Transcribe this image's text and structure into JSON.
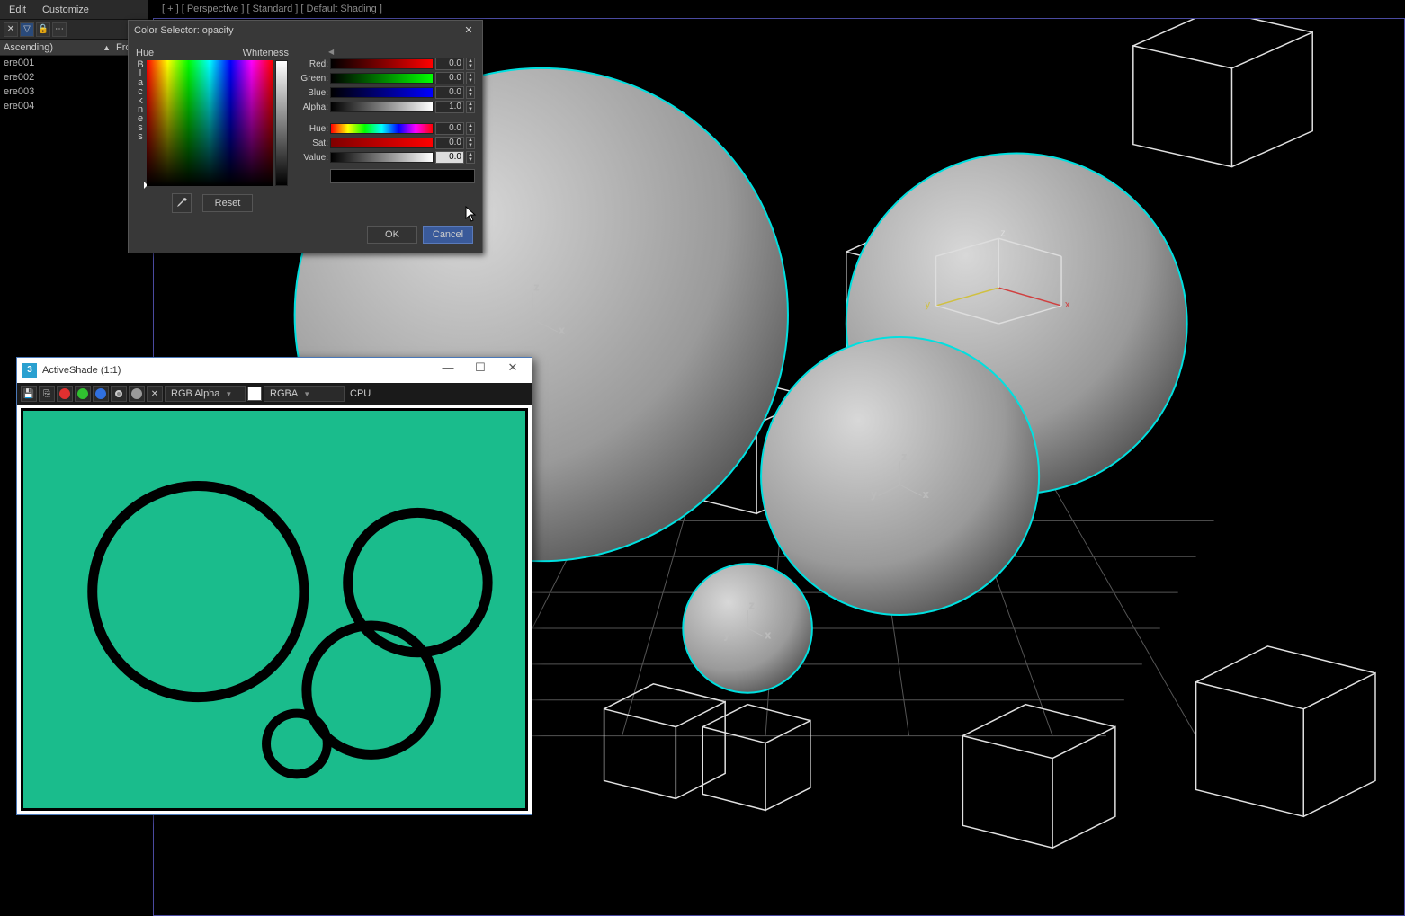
{
  "menu": {
    "edit": "Edit",
    "customize": "Customize"
  },
  "list": {
    "sort_label": "Ascending)",
    "col2": "Froze",
    "items": [
      "ere001",
      "ere002",
      "ere003",
      "ere004"
    ]
  },
  "viewport": {
    "label": "[ + ] [ Perspective ] [ Standard ] [ Default Shading ]",
    "axis": {
      "x": "x",
      "y": "y",
      "z": "z"
    }
  },
  "color_dialog": {
    "title": "Color Selector: opacity",
    "hue_label": "Hue",
    "whiteness_label": "Whiteness",
    "blackness_label": "Blackness",
    "channels": {
      "red": {
        "label": "Red:",
        "value": "0.0"
      },
      "green": {
        "label": "Green:",
        "value": "0.0"
      },
      "blue": {
        "label": "Blue:",
        "value": "0.0"
      },
      "alpha": {
        "label": "Alpha:",
        "value": "1.0"
      },
      "hue": {
        "label": "Hue:",
        "value": "0.0"
      },
      "sat": {
        "label": "Sat:",
        "value": "0.0"
      },
      "val": {
        "label": "Value:",
        "value": "0.0"
      }
    },
    "reset": "Reset",
    "ok": "OK",
    "cancel": "Cancel"
  },
  "activeshade": {
    "title": "ActiveShade (1:1)",
    "channel_select": "RGB Alpha",
    "format_select": "RGBA",
    "renderer": "CPU",
    "bg_color": "#1abc8c"
  }
}
